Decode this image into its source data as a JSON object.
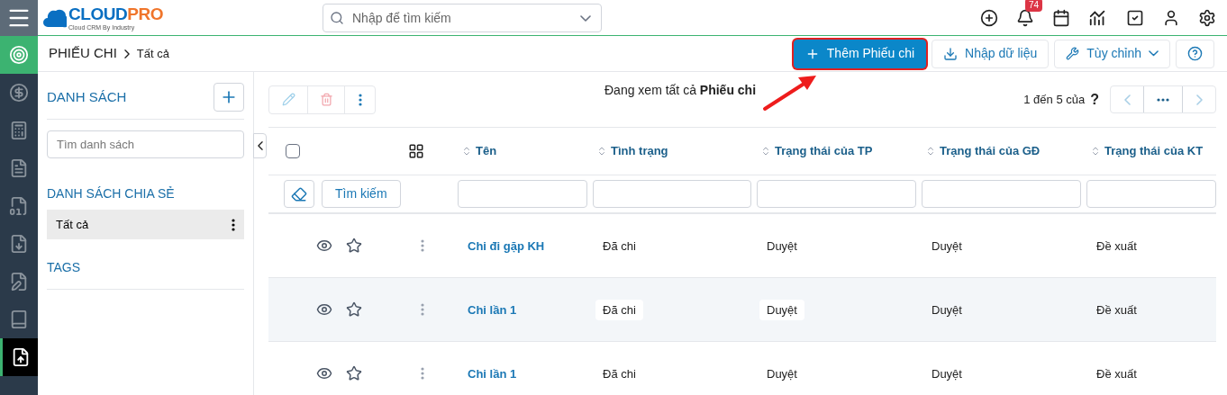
{
  "logo": {
    "brand": "CLOUD",
    "brand_accent": "PRO",
    "tagline": "Cloud CRM By Industry"
  },
  "search": {
    "placeholder": "Nhập để tìm kiếm"
  },
  "notifications": {
    "count": "74"
  },
  "rail": [
    {
      "kind": "home",
      "selected": false
    },
    {
      "kind": "money",
      "selected": false
    },
    {
      "kind": "calc",
      "selected": false
    },
    {
      "kind": "doc",
      "selected": false
    },
    {
      "kind": "dollar",
      "selected": false
    },
    {
      "kind": "download",
      "selected": false
    },
    {
      "kind": "chart",
      "selected": false
    },
    {
      "kind": "book",
      "selected": false
    },
    {
      "kind": "upload",
      "selected": true
    }
  ],
  "breadcrumb": {
    "module": "PHIẾU CHI",
    "view": "Tất cả"
  },
  "actions": [
    {
      "kind": "add",
      "label": "Thêm Phiếu chi",
      "highlighted": true
    },
    {
      "kind": "import",
      "label": "Nhập dữ liệu",
      "highlighted": false
    },
    {
      "kind": "customize",
      "label": "Tùy chỉnh",
      "highlighted": false
    },
    {
      "kind": "help",
      "highlighted": false
    }
  ],
  "sidebar": {
    "lists_title": "DANH SÁCH",
    "list_search_placeholder": "Tìm danh sách",
    "shared_title": "DANH SÁCH CHIA SẺ",
    "shared_items": [
      {
        "label": "Tất cả",
        "selected": true
      }
    ],
    "tags_title": "TAGS"
  },
  "viewing": "Đang xem tất cả **Phiếu chi**",
  "pagination": {
    "range": "1 đến 5 của",
    "total": "?"
  },
  "search_button": "Tìm kiếm",
  "select_all": {
    "checked": false
  },
  "table": {
    "columns": [
      "Tên",
      "Tình trạng",
      "Trạng thái của TP",
      "Trạng thái của GĐ",
      "Trạng thái của KT"
    ],
    "rows": [
      {
        "highlighted": false,
        "cells": [
          "Chi đi gặp KH",
          "Đã chi",
          "Duyệt",
          "Duyệt",
          "Đề xuất"
        ]
      },
      {
        "highlighted": true,
        "cells": [
          "Chi lần 1",
          "Đã chi",
          "Duyệt",
          "Duyệt",
          "Đề xuất"
        ]
      },
      {
        "highlighted": false,
        "cells": [
          "Chi lần 1",
          "Đã chi",
          "Duyệt",
          "Duyệt",
          "Đề xuất"
        ]
      }
    ]
  }
}
